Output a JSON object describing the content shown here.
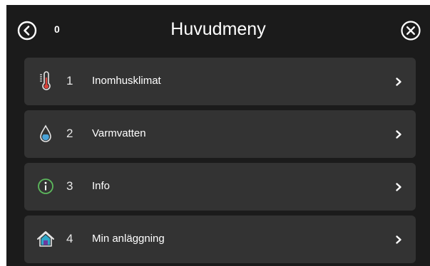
{
  "header": {
    "title": "Huvudmeny",
    "counter": "0",
    "back_icon": "back-circle-icon",
    "close_icon": "close-circle-icon"
  },
  "menu": {
    "items": [
      {
        "number": "1",
        "label": "Inomhusklimat",
        "icon": "thermometer-icon"
      },
      {
        "number": "2",
        "label": "Varmvatten",
        "icon": "water-drop-icon"
      },
      {
        "number": "3",
        "label": "Info",
        "icon": "info-icon"
      },
      {
        "number": "4",
        "label": "Min anläggning",
        "icon": "house-icon"
      }
    ]
  },
  "colors": {
    "background": "#1b1b1b",
    "item_background": "#333333",
    "text": "#ffffff",
    "info_accent": "#5cb85c",
    "drop_accent": "#4aa3d9",
    "thermometer_accent": "#d9413a",
    "house_accent": "#2fa7c9"
  }
}
